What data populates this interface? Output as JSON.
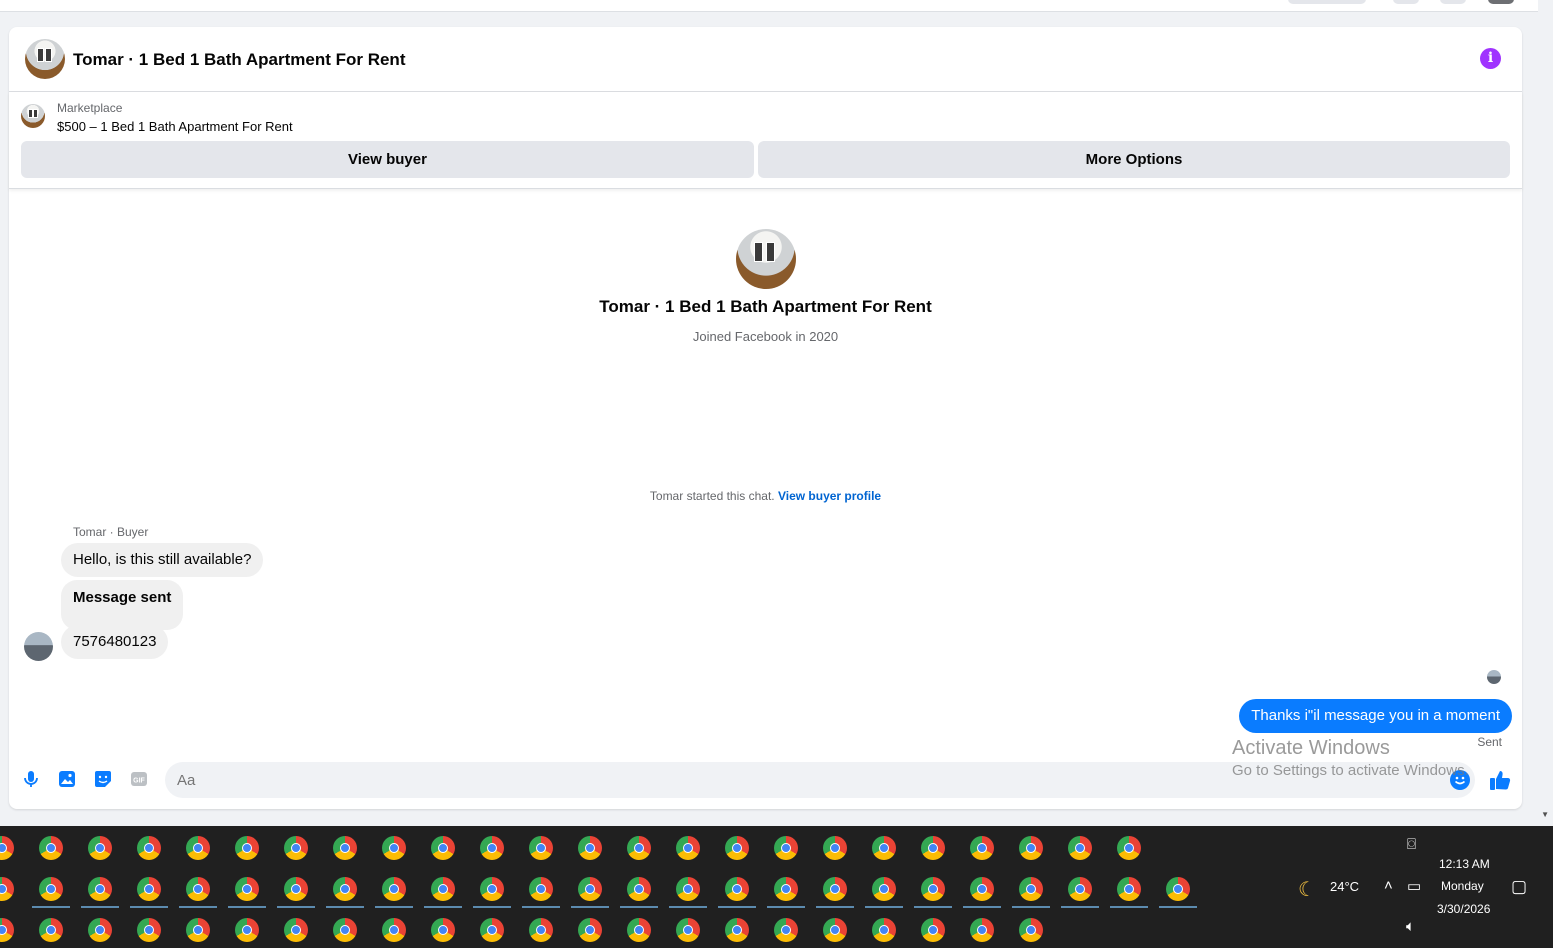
{
  "header": {
    "title": "Tomar · 1 Bed 1 Bath Apartment For Rent"
  },
  "listing": {
    "label": "Marketplace",
    "price_title": "$500 – 1 Bed 1 Bath Apartment For Rent",
    "view_buyer": "View buyer",
    "more_options": "More Options"
  },
  "profile": {
    "name": "Tomar · 1 Bed 1 Bath Apartment For Rent",
    "joined": "Joined Facebook in 2020"
  },
  "chat": {
    "started_text": "Tomar started this chat.",
    "view_profile_link": "View buyer profile",
    "sender_label": "Tomar · Buyer",
    "incoming": [
      "Hello, is this still available?",
      "Message sent",
      "7576480123"
    ],
    "outgoing": "Thanks i\"il message you in a moment",
    "sent_status": "Sent"
  },
  "composer": {
    "placeholder": "Aa"
  },
  "watermark": {
    "line1": "Activate Windows",
    "line2": "Go to Settings to activate Windows."
  },
  "taskbar": {
    "weather": "24°C",
    "time": "12:13 AM",
    "day": "Monday",
    "date": "3/30/2026"
  },
  "colors": {
    "accent_blue": "#0a7cff",
    "link_blue": "#0064d1",
    "info_purple": "#a033ff",
    "taskbar_bg": "#202020"
  }
}
